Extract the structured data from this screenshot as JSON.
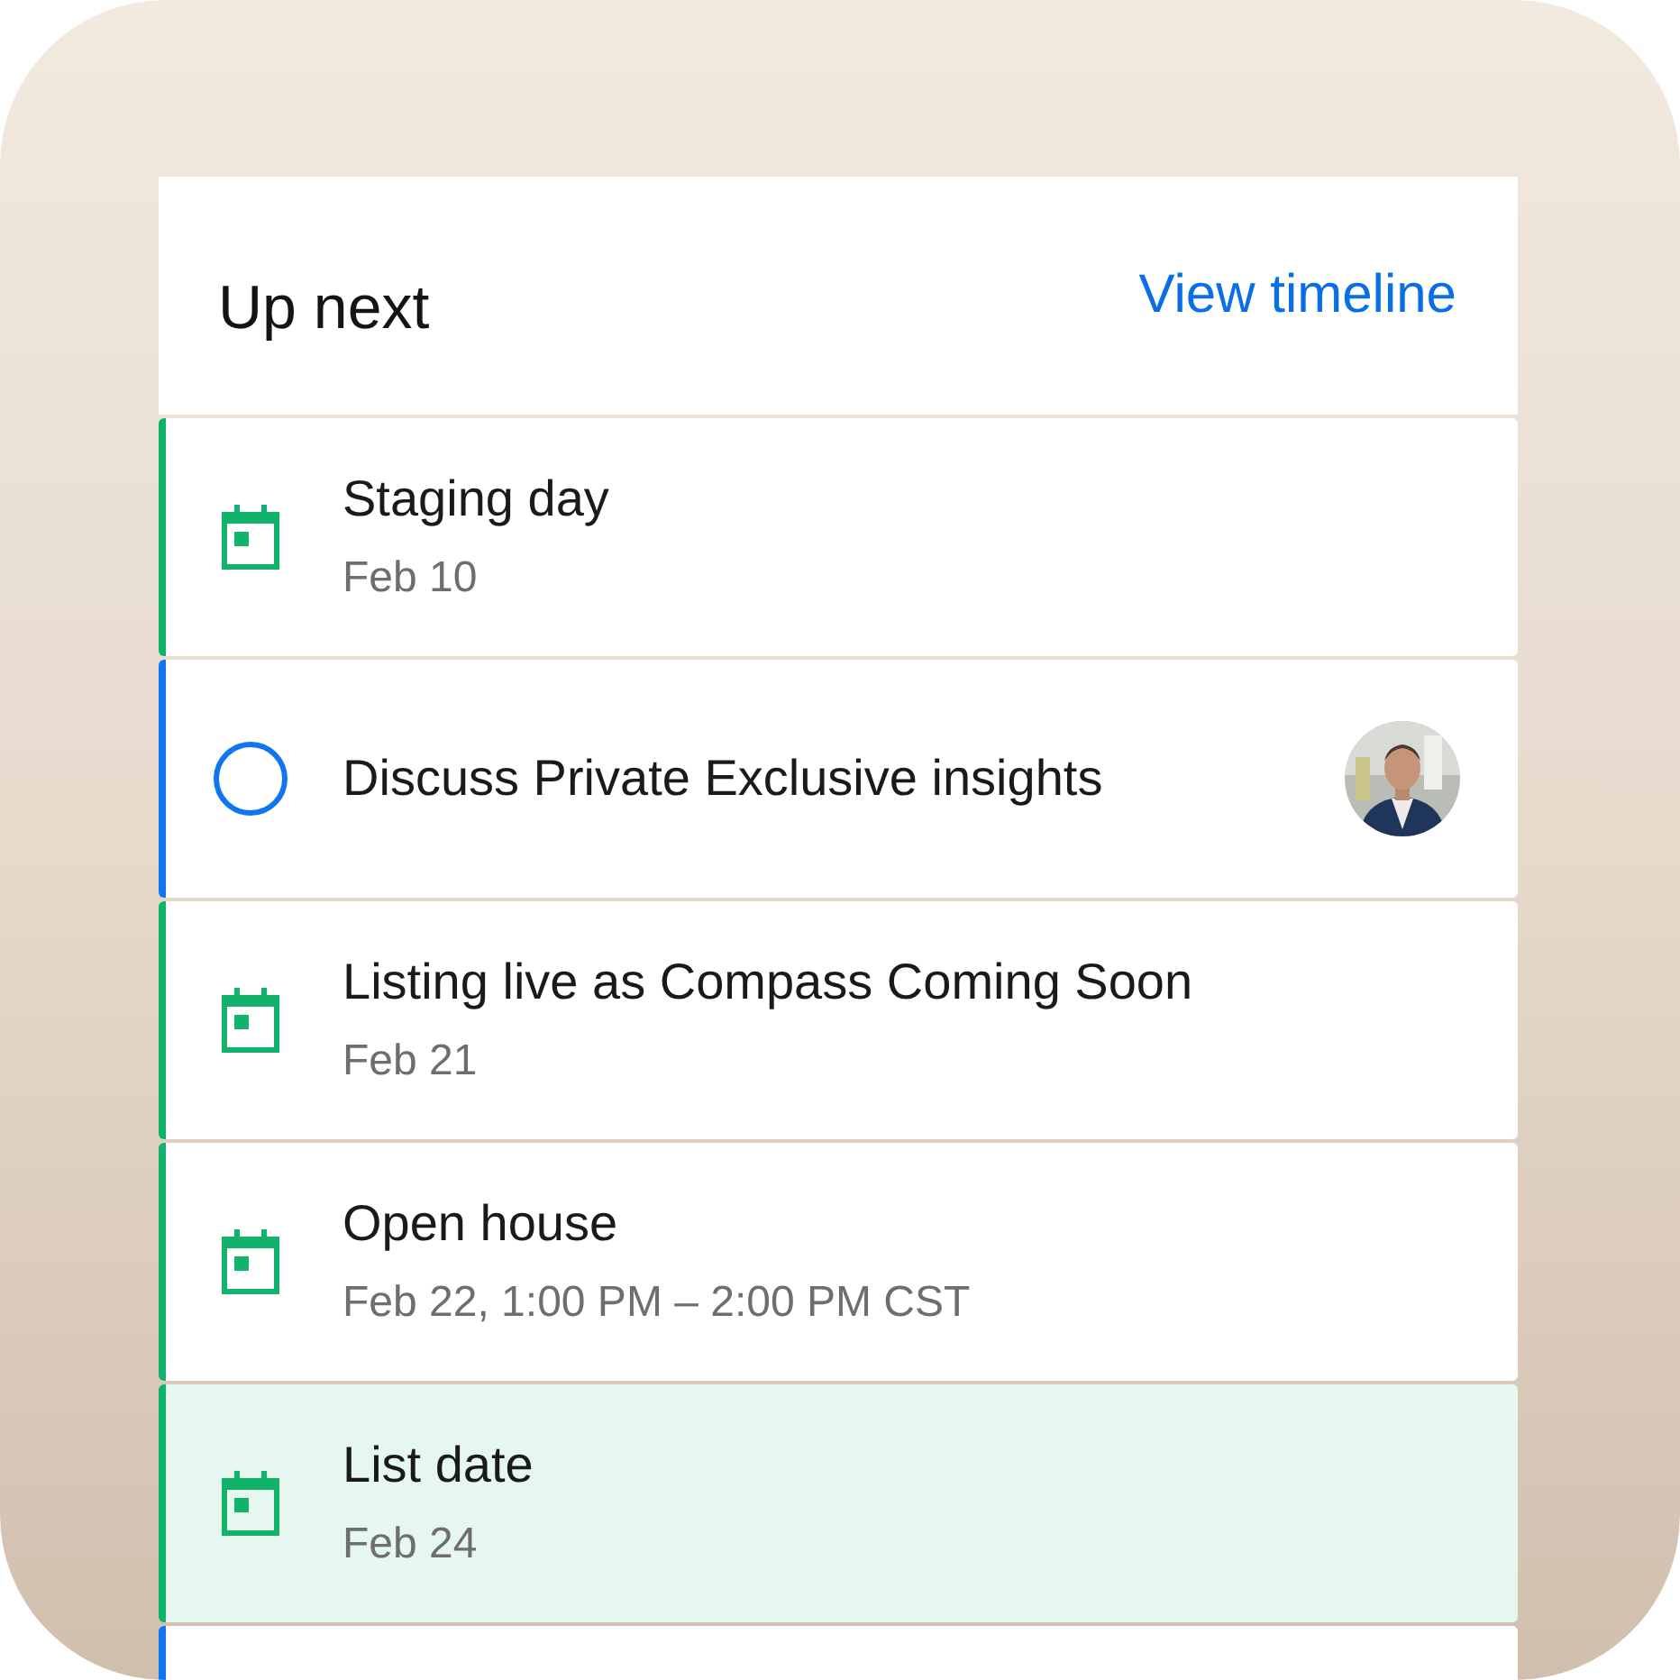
{
  "header": {
    "title": "Up next",
    "link": "View timeline"
  },
  "items": [
    {
      "kind": "event",
      "title": "Staging day",
      "date": "Feb 10",
      "selected": false
    },
    {
      "kind": "task",
      "title": "Discuss Private Exclusive insights",
      "selected": false
    },
    {
      "kind": "event",
      "title": "Listing live as Compass Coming Soon",
      "date": "Feb 21",
      "selected": false
    },
    {
      "kind": "event",
      "title": "Open house",
      "date": "Feb 22, 1:00 PM – 2:00 PM CST",
      "selected": false
    },
    {
      "kind": "event",
      "title": "List date",
      "date": "Feb 24",
      "selected": true
    },
    {
      "kind": "task",
      "selected": false
    }
  ]
}
